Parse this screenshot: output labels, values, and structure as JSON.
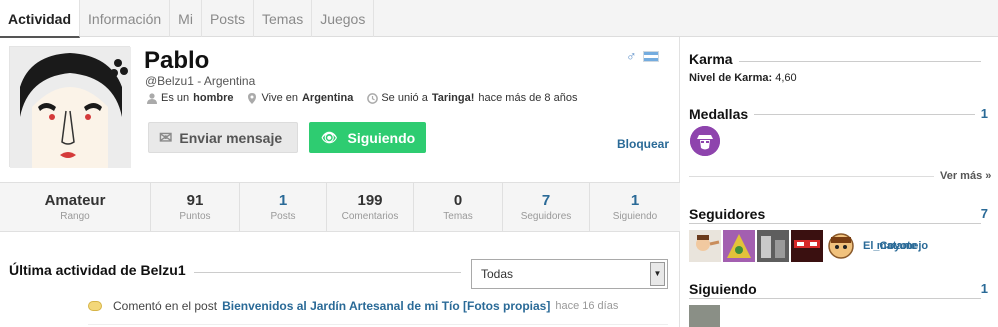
{
  "tabs": [
    {
      "label": "Actividad",
      "active": true
    },
    {
      "label": "Información",
      "active": false
    },
    {
      "label": "Mi",
      "active": false
    },
    {
      "label": "Posts",
      "active": false
    },
    {
      "label": "Temas",
      "active": false
    },
    {
      "label": "Juegos",
      "active": false
    }
  ],
  "profile": {
    "name": "Pablo",
    "handle": "@Belzu1 - Argentina",
    "gender_prefix": "Es un",
    "gender": "hombre",
    "location_prefix": "Vive en",
    "location": "Argentina",
    "joined_prefix": "Se unió a",
    "site": "Taringa!",
    "joined_suffix": "hace más de 8 años",
    "gender_icon": "male-symbol-icon",
    "flag_icon": "argentina-flag-icon"
  },
  "actions": {
    "message_label": "Enviar mensaje",
    "follow_label": "Siguiendo",
    "block_label": "Bloquear"
  },
  "stats": [
    {
      "value": "Amateur",
      "label": "Rango",
      "link": false
    },
    {
      "value": "91",
      "label": "Puntos",
      "link": false
    },
    {
      "value": "1",
      "label": "Posts",
      "link": true
    },
    {
      "value": "199",
      "label": "Comentarios",
      "link": false
    },
    {
      "value": "0",
      "label": "Temas",
      "link": false
    },
    {
      "value": "7",
      "label": "Seguidores",
      "link": true
    },
    {
      "value": "1",
      "label": "Siguiendo",
      "link": true
    }
  ],
  "activity": {
    "title": "Última actividad de Belzu1",
    "filter_value": "Todas",
    "items": [
      {
        "action": "Comentó en el post",
        "post": "Bienvenidos al Jardín Artesanal de mi Tío [Fotos propias]",
        "ago": "hace 16 días"
      }
    ]
  },
  "sidebar": {
    "karma": {
      "title": "Karma",
      "level_label": "Nivel de Karma:",
      "level_value": "4,60"
    },
    "medals": {
      "title": "Medallas",
      "count": "1",
      "more_label": "Ver más »"
    },
    "followers": {
      "title": "Seguidores",
      "count": "7",
      "overlap_names": [
        "El_Coyote",
        "matamejo"
      ]
    },
    "following": {
      "title": "Siguiendo",
      "count": "1"
    }
  },
  "colors": {
    "follow_green": "#2ecc71",
    "link_blue": "#2a6a97",
    "medal_purple": "#8e44ad"
  }
}
